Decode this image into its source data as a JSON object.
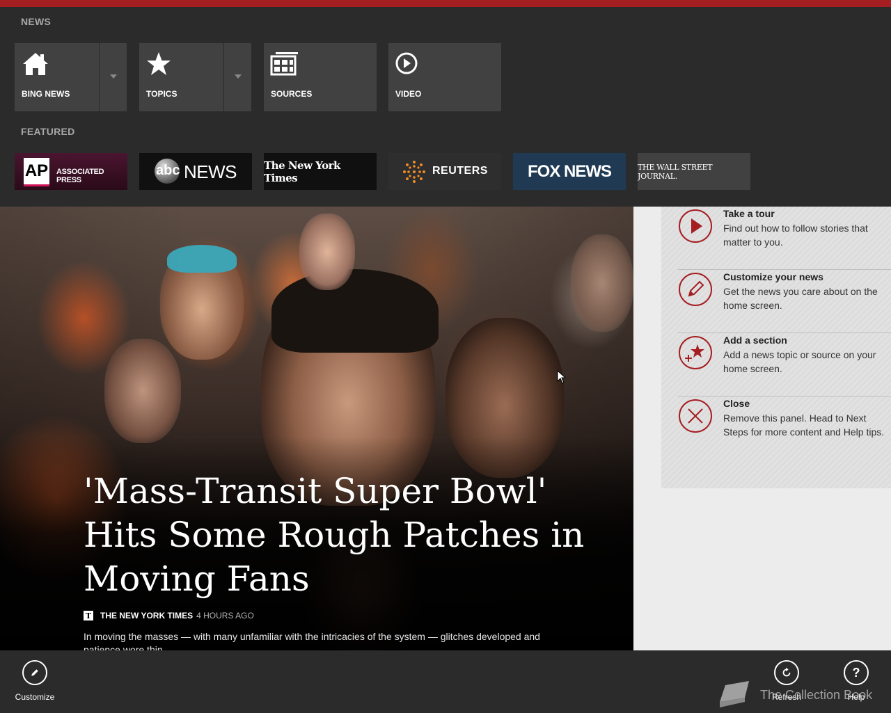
{
  "top_accent": "#a51e22",
  "sections": {
    "news": "NEWS",
    "featured": "FEATURED"
  },
  "tiles": [
    {
      "label": "BING NEWS",
      "icon": "home-icon",
      "has_dropdown": true
    },
    {
      "label": "TOPICS",
      "icon": "star-icon",
      "has_dropdown": true
    },
    {
      "label": "SOURCES",
      "icon": "sources-grid-icon",
      "has_dropdown": false
    },
    {
      "label": "VIDEO",
      "icon": "play-circle-icon",
      "has_dropdown": false
    }
  ],
  "featured": [
    {
      "logo_text_1": "AP",
      "logo_text_2": "ASSOCIATED PRESS",
      "bg": "#3b0f22"
    },
    {
      "logo_text_1": "abc",
      "logo_text_2": "NEWS",
      "bg": "#101010"
    },
    {
      "logo_text_1": "The New York Times",
      "bg": "#101010"
    },
    {
      "logo_text_1": "REUTERS",
      "bg": "#2e2e2e"
    },
    {
      "logo_text_1": "FOX NEWS",
      "bg": "#1f3a52"
    },
    {
      "logo_text_1": "THE WALL STREET JOURNAL.",
      "bg": "#414141"
    }
  ],
  "hero": {
    "headline": "'Mass-Transit Super Bowl' Hits Some Rough Patches in Moving Fans",
    "source": "THE NEW YORK TIMES",
    "time": "4 HOURS AGO",
    "summary": "In moving the masses — with many unfamiliar with the intricacies of the system — glitches developed and patience wore thin."
  },
  "side_panel": [
    {
      "title": "Take a tour",
      "desc": "Find out how to follow stories that matter to you.",
      "icon": "play-icon"
    },
    {
      "title": "Customize your news",
      "desc": "Get the news you care about on the home screen.",
      "icon": "pencil-icon"
    },
    {
      "title": "Add a section",
      "desc": "Add a news topic or source on your home screen.",
      "icon": "add-star-icon"
    },
    {
      "title": "Close",
      "desc": "Remove this panel. Head to Next Steps for more content and Help tips.",
      "icon": "close-icon"
    }
  ],
  "appbar": {
    "customize": "Customize",
    "refresh": "Refresh",
    "help": "Help"
  },
  "watermark": "The Collection Book"
}
